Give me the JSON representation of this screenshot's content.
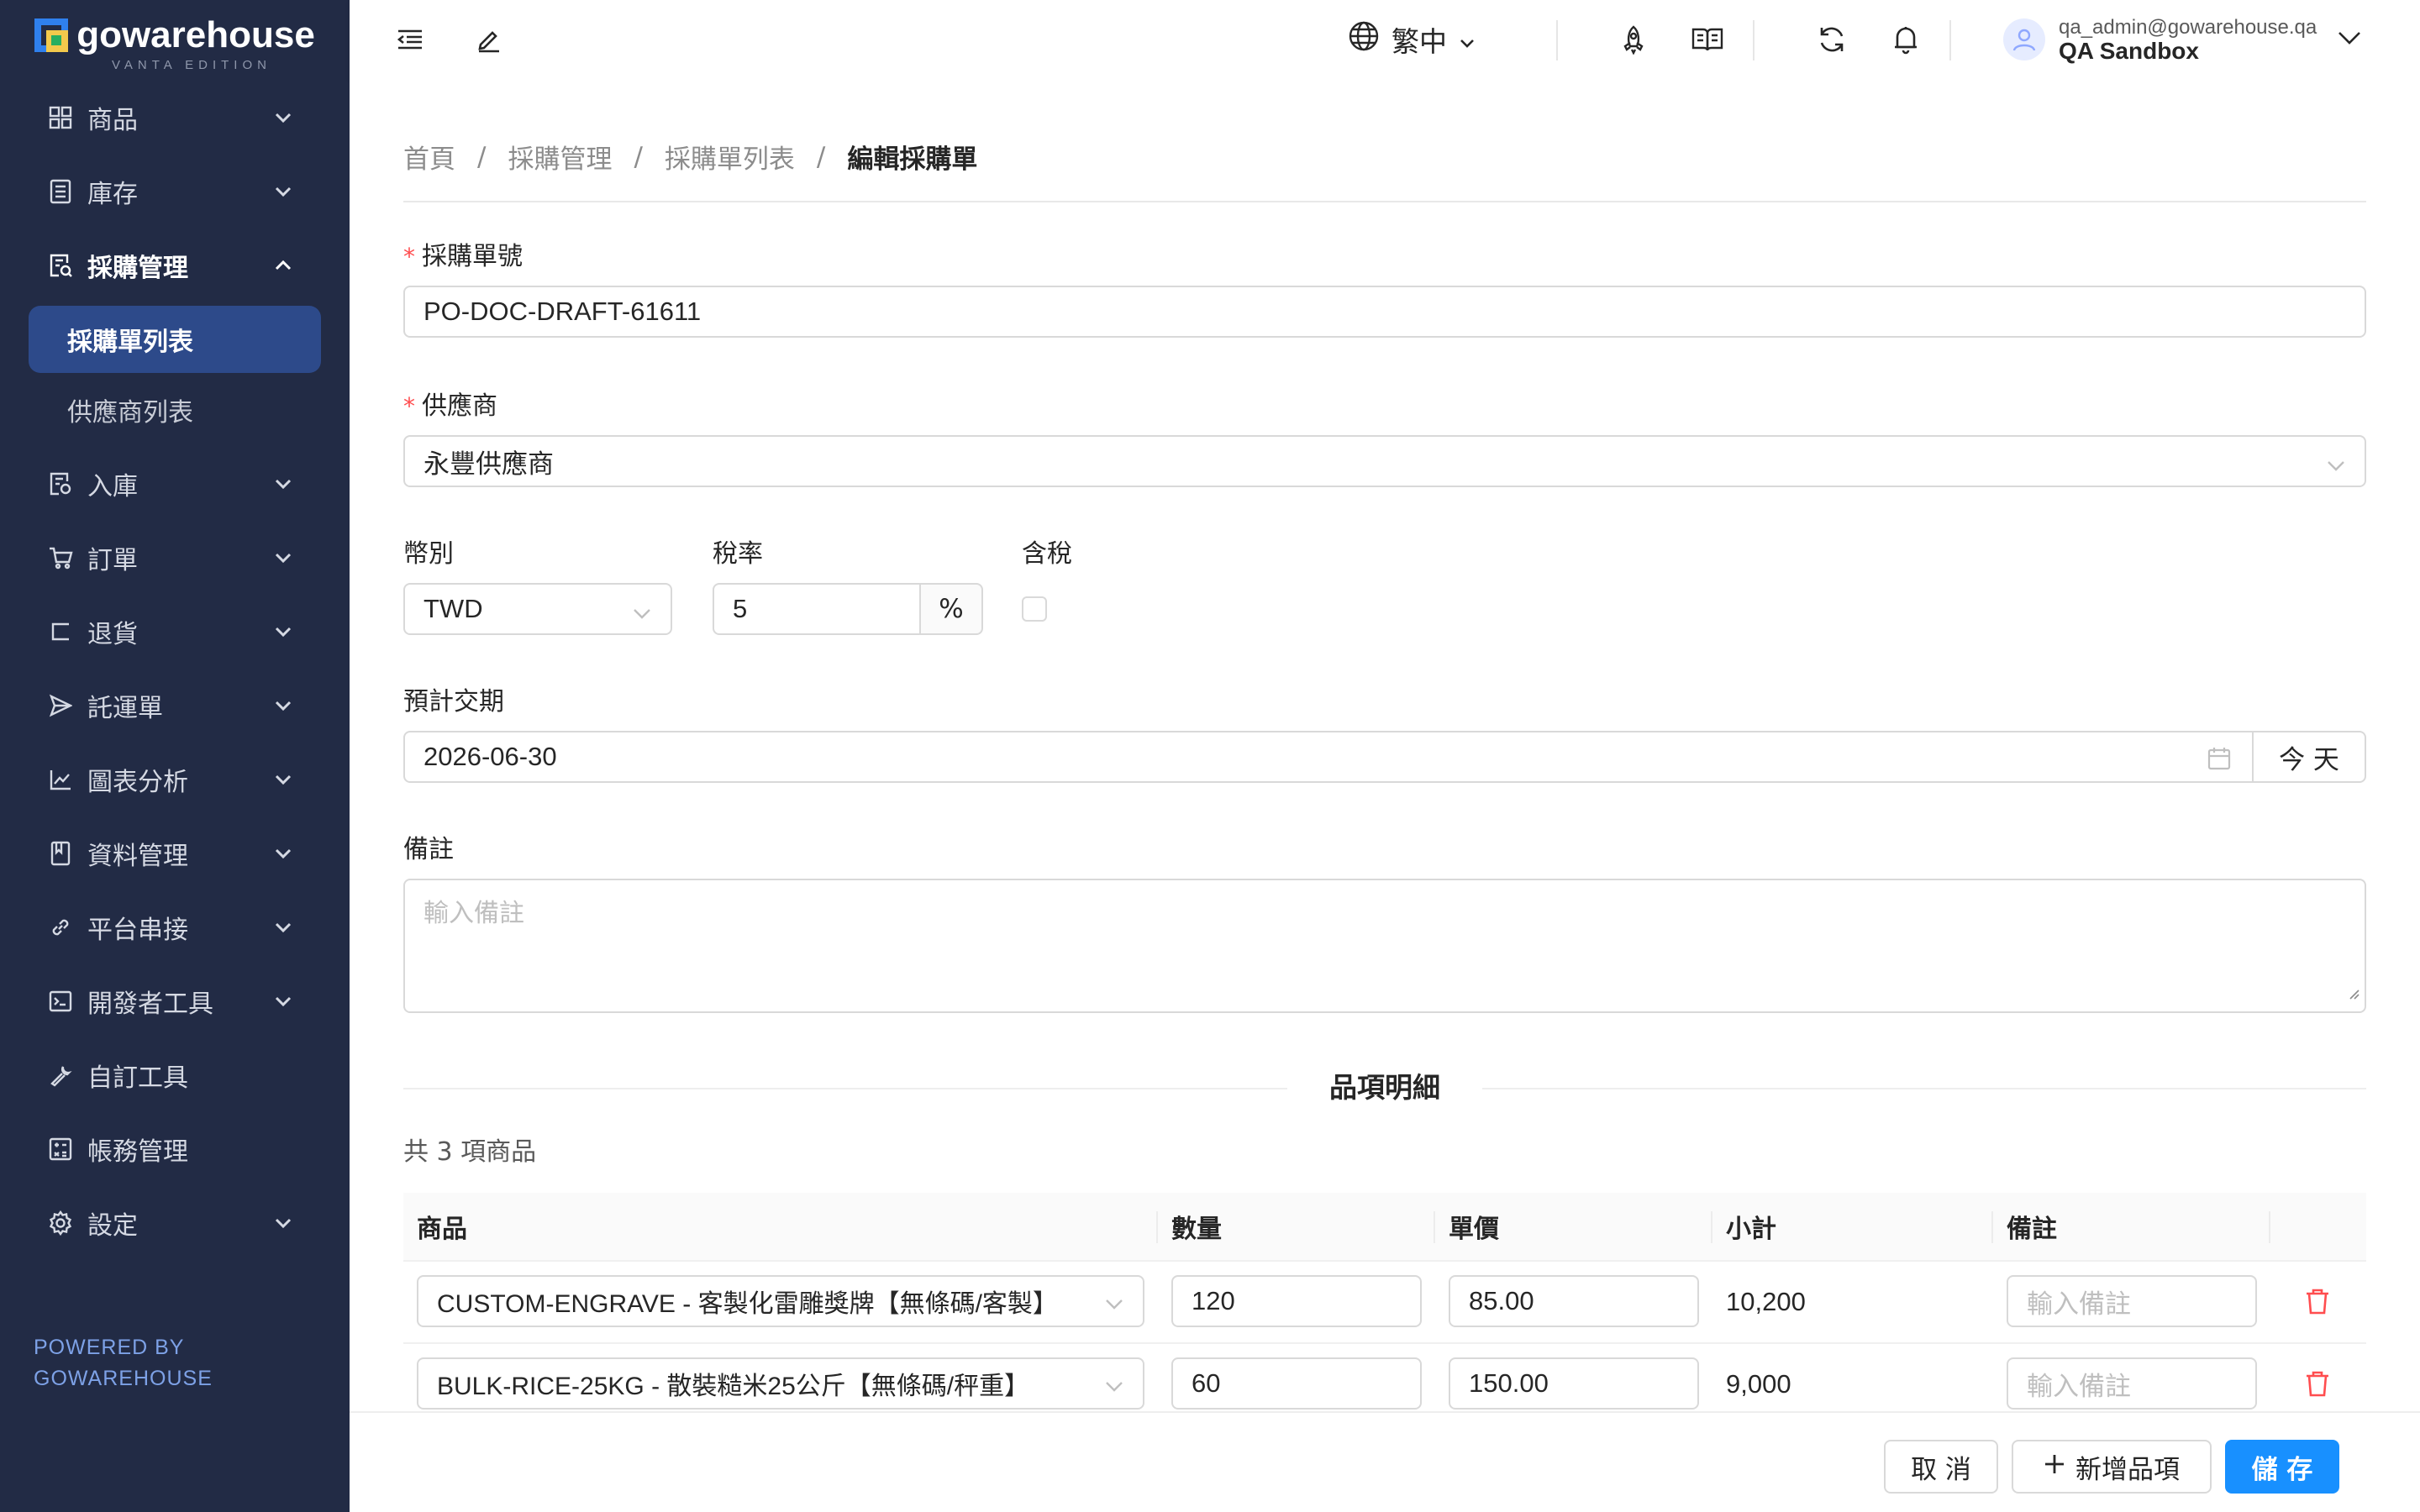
{
  "brand": {
    "name": "gowarehouse",
    "edition": "VANTA EDITION",
    "colors": {
      "blue": "#2f80ed",
      "yellow": "#f2c94c",
      "green": "#27ae60"
    }
  },
  "sidebar": {
    "bg": "#222b45",
    "active_bg": "#2d4a8a",
    "items": [
      {
        "label": "商品",
        "icon": "grid-icon",
        "expandable": true,
        "open": false
      },
      {
        "label": "庫存",
        "icon": "inventory-list-icon",
        "expandable": true,
        "open": false
      },
      {
        "label": "採購管理",
        "icon": "purchase-doc-icon",
        "expandable": true,
        "open": true,
        "children": [
          {
            "label": "採購單列表",
            "active": true
          },
          {
            "label": "供應商列表",
            "active": false
          }
        ]
      },
      {
        "label": "入庫",
        "icon": "inbound-doc-icon",
        "expandable": true,
        "open": false
      },
      {
        "label": "訂單",
        "icon": "cart-icon",
        "expandable": true,
        "open": false
      },
      {
        "label": "退貨",
        "icon": "return-icon",
        "expandable": true,
        "open": false
      },
      {
        "label": "託運單",
        "icon": "send-icon",
        "expandable": true,
        "open": false
      },
      {
        "label": "圖表分析",
        "icon": "line-chart-icon",
        "expandable": true,
        "open": false
      },
      {
        "label": "資料管理",
        "icon": "book-icon",
        "expandable": true,
        "open": false
      },
      {
        "label": "平台串接",
        "icon": "link-icon",
        "expandable": true,
        "open": false
      },
      {
        "label": "開發者工具",
        "icon": "terminal-icon",
        "expandable": true,
        "open": false
      },
      {
        "label": "自訂工具",
        "icon": "wrench-icon",
        "expandable": false,
        "open": false
      },
      {
        "label": "帳務管理",
        "icon": "calculator-icon",
        "expandable": false,
        "open": false
      },
      {
        "label": "設定",
        "icon": "gear-icon",
        "expandable": true,
        "open": false
      }
    ],
    "powered_line1": "POWERED BY",
    "powered_line2": "GOWAREHOUSE"
  },
  "header": {
    "language": "繁中",
    "user_email": "qa_admin@gowarehouse.qa",
    "user_org": "QA Sandbox"
  },
  "breadcrumb": [
    "首頁",
    "採購管理",
    "採購單列表",
    "編輯採購單"
  ],
  "form": {
    "po_number_label": "採購單號",
    "po_number": "PO-DOC-DRAFT-61611",
    "supplier_label": "供應商",
    "supplier": "永豐供應商",
    "currency_label": "幣別",
    "currency": "TWD",
    "tax_rate_label": "稅率",
    "tax_rate": "5",
    "tax_unit": "%",
    "tax_included_label": "含稅",
    "tax_included": false,
    "delivery_label": "預計交期",
    "delivery_date": "2026-06-30",
    "today_label": "今 天",
    "notes_label": "備註",
    "notes_placeholder": "輸入備註"
  },
  "items_section": {
    "title": "品項明細",
    "count_text": "共 3 項商品",
    "columns": [
      "商品",
      "數量",
      "單價",
      "小計",
      "備註"
    ],
    "rows": [
      {
        "product": "CUSTOM-ENGRAVE - 客製化雷雕獎牌【無條碼/客製】",
        "qty": "120",
        "price": "85.00",
        "subtotal": "10,200",
        "note_placeholder": "輸入備註"
      },
      {
        "product": "BULK-RICE-25KG - 散裝糙米25公斤【無條碼/秤重】",
        "qty": "60",
        "price": "150.00",
        "subtotal": "9,000",
        "note_placeholder": "輸入備註"
      }
    ]
  },
  "footer": {
    "cancel": "取 消",
    "add_item": "新增品項",
    "save": "儲 存",
    "primary_color": "#1890ff"
  }
}
